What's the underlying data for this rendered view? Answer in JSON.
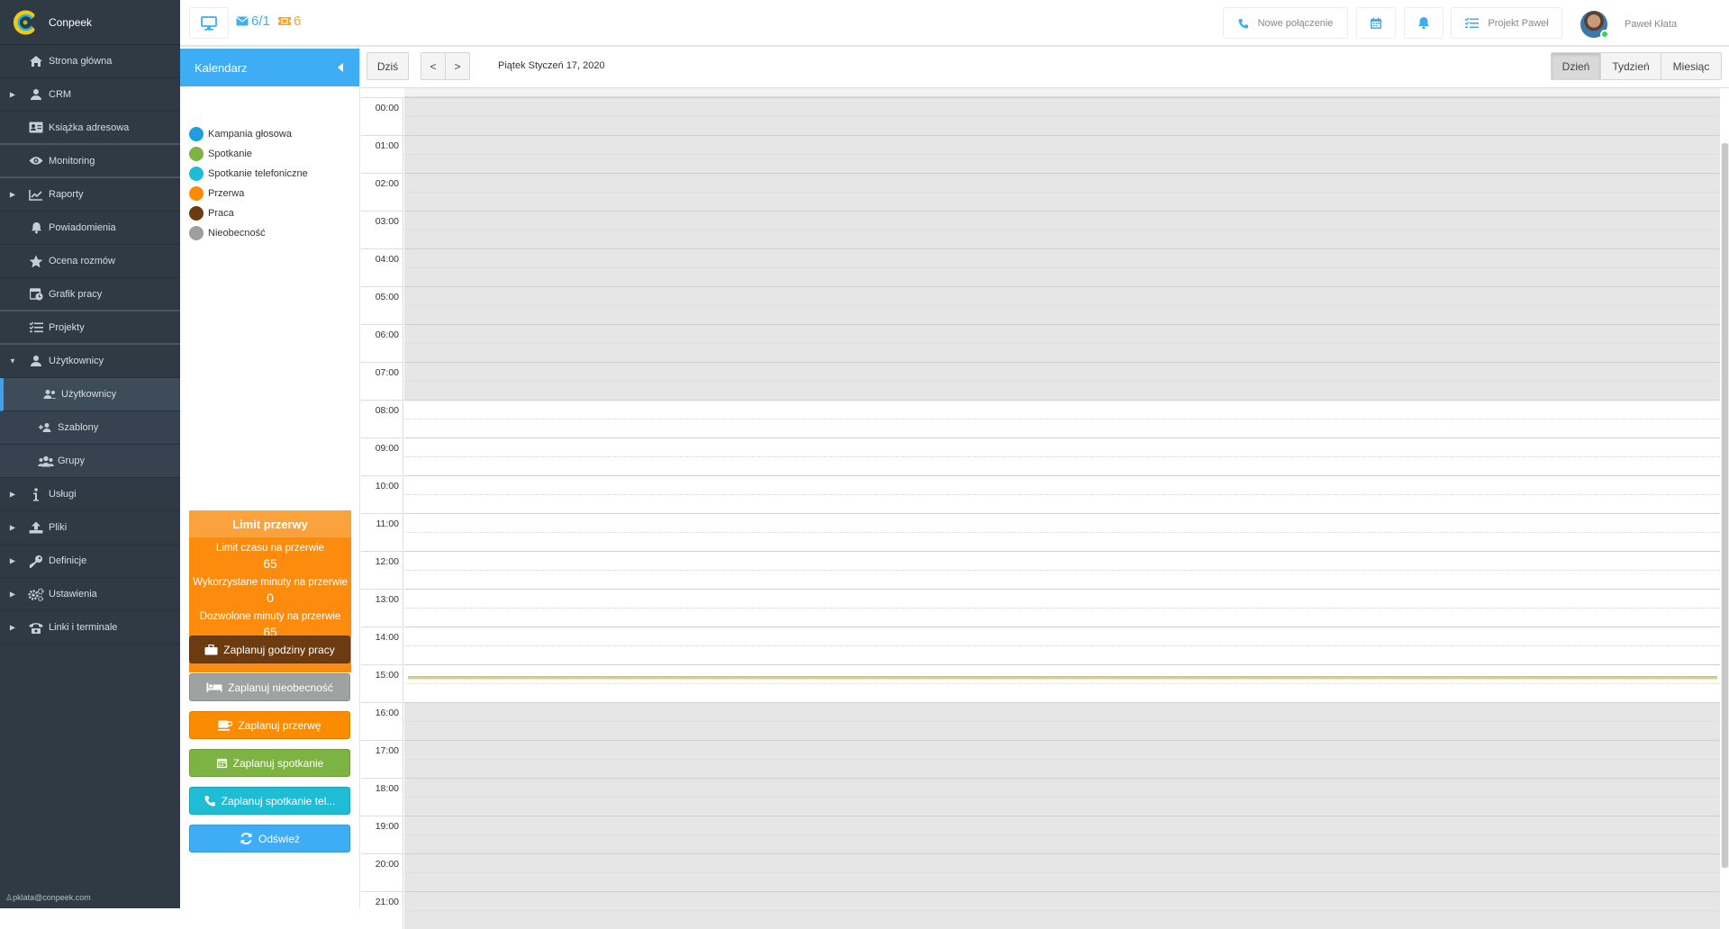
{
  "app": {
    "name": "Conpeek",
    "user_email": "pklata@conpeek.com"
  },
  "sidebar": {
    "items": [
      {
        "label": "Strona główna",
        "icon": "home-icon",
        "arrow": false
      },
      {
        "label": "CRM",
        "icon": "user-icon",
        "arrow": true
      },
      {
        "label": "Książka adresowa",
        "icon": "address-book-icon",
        "arrow": false
      },
      {
        "label": "Monitoring",
        "icon": "eye-icon",
        "arrow": false
      },
      {
        "label": "Raporty",
        "icon": "chart-line-icon",
        "arrow": true
      },
      {
        "label": "Powiadomienia",
        "icon": "bell-icon",
        "arrow": false
      },
      {
        "label": "Ocena rozmów",
        "icon": "star-icon",
        "arrow": false
      },
      {
        "label": "Grafik pracy",
        "icon": "calendar-clock-icon",
        "arrow": false
      },
      {
        "label": "Projekty",
        "icon": "tasks-icon",
        "arrow": false
      },
      {
        "label": "Użytkownicy",
        "icon": "user-icon",
        "arrow": true,
        "expanded": true
      },
      {
        "label": "Użytkownicy",
        "icon": "users-icon",
        "sub": true,
        "active": true
      },
      {
        "label": "Szablony",
        "icon": "user-plus-icon",
        "sub": true
      },
      {
        "label": "Grupy",
        "icon": "group-icon",
        "sub": true
      },
      {
        "label": "Usługi",
        "icon": "info-icon",
        "arrow": true
      },
      {
        "label": "Pliki",
        "icon": "upload-icon",
        "arrow": true
      },
      {
        "label": "Definicje",
        "icon": "key-icon",
        "arrow": true
      },
      {
        "label": "Ustawienia",
        "icon": "cogs-icon",
        "arrow": true
      },
      {
        "label": "Linki i terminale",
        "icon": "phone-icon",
        "arrow": true
      }
    ]
  },
  "topbar": {
    "messages": "6/1",
    "tickets": "6",
    "new_call": "Nowe połączenie",
    "project": "Projekt Paweł",
    "user_name": "Paweł Kłata"
  },
  "calendar_panel": {
    "title": "Kalendarz",
    "legend": [
      {
        "label": "Kampania głosowa",
        "color": "#1e9ee0"
      },
      {
        "label": "Spotkanie",
        "color": "#7cb342"
      },
      {
        "label": "Spotkanie telefoniczne",
        "color": "#1fbcd6"
      },
      {
        "label": "Przerwa",
        "color": "#fb8c00"
      },
      {
        "label": "Praca",
        "color": "#6d3b10"
      },
      {
        "label": "Nieobecność",
        "color": "#9e9e9e"
      }
    ],
    "limit": {
      "title": "Limit przerwy",
      "time_limit_label": "Limit czasu na przerwie",
      "time_limit_value": "65",
      "used_label": "Wykorzystane minuty na przerwie",
      "used_value": "0",
      "allowed_label": "Dozwolone minuty na przerwie",
      "allowed_value": "65"
    },
    "buttons": [
      {
        "label": "Zaplanuj godziny pracy",
        "icon": "briefcase-icon",
        "color": "#6d3b10"
      },
      {
        "label": "Zaplanuj nieobecność",
        "icon": "bed-icon",
        "color": "#9ea3a1"
      },
      {
        "label": "Zaplanuj przerwę",
        "icon": "coffee-icon",
        "color": "#fb8c00"
      },
      {
        "label": "Zaplanuj spotkanie",
        "icon": "calendar-icon",
        "color": "#7cb342"
      },
      {
        "label": "Zaplanuj spotkanie tel...",
        "icon": "phone-icon",
        "color": "#1fbcd6"
      },
      {
        "label": "Odśwież",
        "icon": "refresh-icon",
        "color": "#3fadf5"
      }
    ]
  },
  "calendar": {
    "today_label": "Dziś",
    "prev_label": "<",
    "next_label": ">",
    "date_label": "Piątek Styczeń 17, 2020",
    "views": [
      "Dzień",
      "Tydzień",
      "Miesiąc"
    ],
    "active_view": "Dzień",
    "hours": [
      "00:00",
      "01:00",
      "02:00",
      "03:00",
      "04:00",
      "05:00",
      "06:00",
      "07:00",
      "08:00",
      "09:00",
      "10:00",
      "11:00",
      "12:00",
      "13:00",
      "14:00",
      "15:00",
      "16:00",
      "17:00",
      "18:00",
      "19:00",
      "20:00",
      "21:00"
    ],
    "working_hours": [
      "08:00",
      "15:00"
    ],
    "now_time": "15:30"
  }
}
